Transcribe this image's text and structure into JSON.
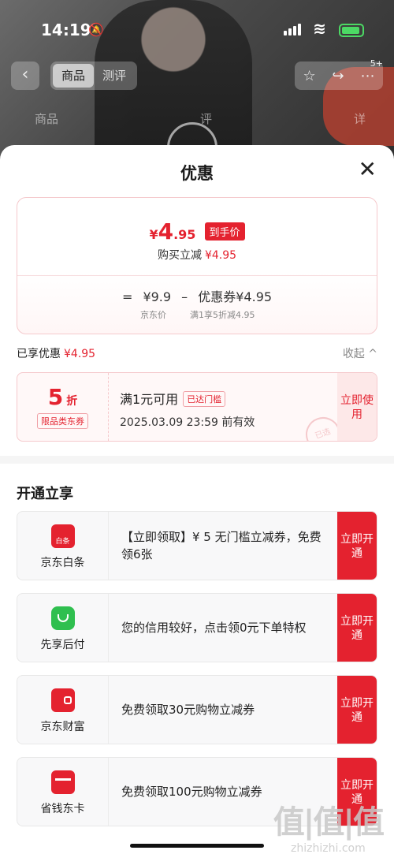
{
  "status_bar": {
    "time": "14:19"
  },
  "topbar": {
    "tabs": [
      "商品",
      "测评"
    ],
    "badge": "5+"
  },
  "bg_tabs": [
    "商品",
    "评",
    "详"
  ],
  "sheet": {
    "title": "优惠",
    "close": "✕"
  },
  "price_card": {
    "currency": "¥",
    "final_int": "4",
    "final_dec": ".95",
    "final_tag": "到手价",
    "reduce_label": "购买立减",
    "reduce_value": "¥4.95",
    "formula_eq": "=",
    "jd_price": "¥9.9",
    "minus": "–",
    "coupon_part": "优惠券¥4.95",
    "jd_price_label": "京东价",
    "coupon_rule": "满1享5折减4.95"
  },
  "enjoyed": {
    "label": "已享优惠",
    "value": "¥4.95",
    "collapse": "收起 ^"
  },
  "coupon": {
    "discount": "5",
    "discount_unit": "折",
    "type": "限品类东券",
    "condition": "满1元可用",
    "reached": "已达门槛",
    "expire": "2025.03.09 23:59 前有效",
    "use_btn": "立即使用",
    "stamp": "已选"
  },
  "section": {
    "title": "开通立享"
  },
  "services": [
    {
      "name": "京东白条",
      "icon_text": "白条",
      "desc": "【立即领取】¥ 5 无门槛立减券，免费领6张",
      "btn": "立即开通"
    },
    {
      "name": "先享后付",
      "icon_text": "",
      "desc": "您的信用较好，点击领0元下单特权",
      "btn": "立即开通"
    },
    {
      "name": "京东财富",
      "icon_text": "",
      "desc": "免费领取30元购物立减券",
      "btn": "立即开通"
    },
    {
      "name": "省钱东卡",
      "icon_text": "",
      "desc": "免费领取100元购物立减券",
      "btn": "立即开通"
    }
  ],
  "watermark": {
    "big": "值|值|值",
    "small": "zhizhizhi.com"
  },
  "colors": {
    "accent": "#e4222f",
    "green": "#2fbf4f"
  }
}
